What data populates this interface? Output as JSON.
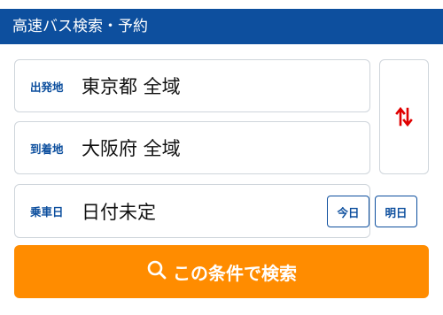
{
  "header": {
    "title": "高速バス検索・予約"
  },
  "form": {
    "departure": {
      "label": "出発地",
      "value": "東京都 全域"
    },
    "arrival": {
      "label": "到着地",
      "value": "大阪府 全域"
    },
    "date": {
      "label": "乗車日",
      "value": "日付未定",
      "today_label": "今日",
      "tomorrow_label": "明日"
    },
    "swap_icon": "swap-vertical-arrows-icon"
  },
  "search_button": {
    "label": "この条件で検索",
    "icon": "search-icon"
  },
  "colors": {
    "brand_blue": "#0d4f9e",
    "accent_orange": "#ff8c00",
    "swap_red": "#e00000",
    "border": "#cfd5db"
  }
}
